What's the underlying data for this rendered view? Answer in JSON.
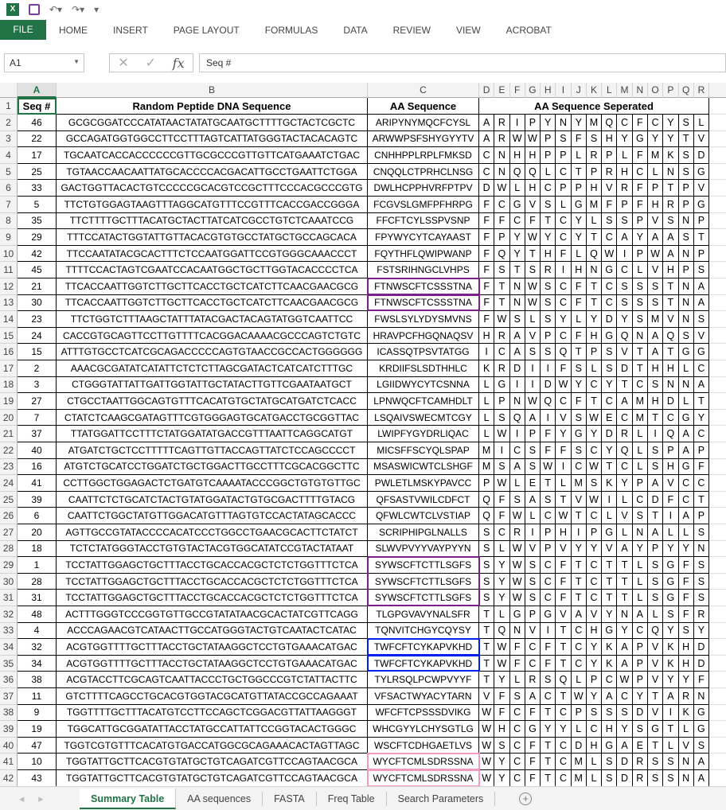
{
  "ribbon": {
    "file": "FILE",
    "tabs": [
      "HOME",
      "INSERT",
      "PAGE LAYOUT",
      "FORMULAS",
      "DATA",
      "REVIEW",
      "VIEW",
      "ACROBAT"
    ]
  },
  "formula_bar": {
    "name_box": "A1",
    "formula": "Seq #",
    "fx": "fx"
  },
  "columns": [
    "A",
    "B",
    "C",
    "D",
    "E",
    "F",
    "G",
    "H",
    "I",
    "J",
    "K",
    "L",
    "M",
    "N",
    "O",
    "P",
    "Q",
    "R"
  ],
  "headers": {
    "seq": "Seq #",
    "dna": "Random Peptide DNA Sequence",
    "aa": "AA Sequence",
    "sep": "AA Sequence Seperated"
  },
  "box_colors": {
    "purple": "#7B1F8A",
    "blue": "#0020F0",
    "pink": "#F49AC1"
  },
  "rows": [
    {
      "seq": "46",
      "dna": "GCGCGGATCCCATATAACTATATGCAATGCTTTTGCTACTCGCTC",
      "aa": "ARIPYNYMQCFCYSL"
    },
    {
      "seq": "22",
      "dna": "GCCAGATGGTGGCCTTCCTTTAGTCATTATGGGTACTACACAGTC",
      "aa": "ARWWPSFSHYGYYTV"
    },
    {
      "seq": "17",
      "dna": "TGCAATCACCACCCCCCGTTGCGCCCGTTGTTCATGAAATCTGAC",
      "aa": "CNHHPPLRPLFMKSD"
    },
    {
      "seq": "25",
      "dna": "TGTAACCAACAATTATGCACCCCACGACATTGCCTGAATTCTGGA",
      "aa": "CNQQLCTPRHCLNSG"
    },
    {
      "seq": "33",
      "dna": "GACTGGTTACACTGTCCCCCGCACGTCCGCTTTCCCACGCCCGTG",
      "aa": "DWLHCPPHVRFPTPV"
    },
    {
      "seq": "5",
      "dna": "TTCTGTGGAGTAAGTTTAGGCATGTTTCCGTTTCACCGACCGGGA",
      "aa": "FCGVSLGMFPFHRPG"
    },
    {
      "seq": "35",
      "dna": "TTCTTTTGCTTTACATGCTACTTATCATCGCCTGTCTCAAATCCG",
      "aa": "FFCFTCYLSSPVSNP"
    },
    {
      "seq": "29",
      "dna": "TTTCCATACTGGTATTGTTACACGTGTGCCTATGCTGCCAGCACA",
      "aa": "FPYWYCYTCAYAAST"
    },
    {
      "seq": "42",
      "dna": "TTCCAATATACGCACTTTCTCCAATGGATTCCGTGGGCAAACCCT",
      "aa": "FQYTHFLQWIPWANP"
    },
    {
      "seq": "45",
      "dna": "TTTTCCACTAGTCGAATCCACAATGGCTGCTTGGTACACCCCTCA",
      "aa": "FSTSRIHNGCLVHPS"
    },
    {
      "seq": "21",
      "dna": "TTCACCAATTGGTCTTGCTTCACCTGCTCATCTTCAACGAACGCG",
      "aa": "FTNWSCFTCSSSTNA",
      "box": "purple"
    },
    {
      "seq": "30",
      "dna": "TTCACCAATTGGTCTTGCTTCACCTGCTCATCTTCAACGAACGCG",
      "aa": "FTNWSCFTCSSSTNA",
      "box": "purple"
    },
    {
      "seq": "23",
      "dna": "TTCTGGTCTTTAAGCTATTTATACGACTACAGTATGGTCAATTCC",
      "aa": "FWSLSYLYDYSMVNS"
    },
    {
      "seq": "24",
      "dna": "CACCGTGCAGTTCCTTGTTTTCACGGACAAAACGCCCAGTCTGTC",
      "aa": "HRAVPCFHGQNAQSV"
    },
    {
      "seq": "15",
      "dna": "ATTTGTGCCTCATCGCAGACCCCCAGTGTAACCGCCACTGGGGGG",
      "aa": "ICASSQTPSVTATGG"
    },
    {
      "seq": "2",
      "dna": "AAACGCGATATCATATTCTCTCTTAGCGATACTCATCATCTTTGC",
      "aa": "KRDIIFSLSDTHHLC"
    },
    {
      "seq": "3",
      "dna": "CTGGGTATTATTGATTGGTATTGCTATACTTGTTCGAATAATGCT",
      "aa": "LGIIDWYCYTCSNNA"
    },
    {
      "seq": "27",
      "dna": "CTGCCTAATTGGCAGTGTTTCACATGTGCTATGCATGATCTCACC",
      "aa": "LPNWQCFTCAMHDLT"
    },
    {
      "seq": "7",
      "dna": "CTATCTCAAGCGATAGTTTCGTGGGAGTGCATGACCTGCGGTTAC",
      "aa": "LSQAIVSWECMTCGY"
    },
    {
      "seq": "37",
      "dna": "TTATGGATTCCTTTCTATGGATATGACCGTTTAATTCAGGCATGT",
      "aa": "LWIPFYGYDRLIQAC"
    },
    {
      "seq": "40",
      "dna": "ATGATCTGCTCCTTTTTCAGTTGTTACCAGTTATCTCCAGCCCCT",
      "aa": "MICSFFSCYQLSPAP"
    },
    {
      "seq": "16",
      "dna": "ATGTCTGCATCCTGGATCTGCTGGACTTGCCTTTCGCACGGCTTC",
      "aa": "MSASWICWTCLSHGF"
    },
    {
      "seq": "41",
      "dna": "CCTTGGCTGGAGACTCTGATGTCAAAATACCCGGCTGTGTGTTGC",
      "aa": "PWLETLMSKYPAVCC"
    },
    {
      "seq": "39",
      "dna": "CAATTCTCTGCATCTACTGTATGGATACTGTGCGACTTTTGTACG",
      "aa": "QFSASTVWILCDFCT"
    },
    {
      "seq": "6",
      "dna": "CAATTCTGGCTATGTTGGACATGTTTAGTGTCCACTATAGCACCC",
      "aa": "QFWLCWTCLVSTIAP"
    },
    {
      "seq": "20",
      "dna": "AGTTGCCGTATACCCCACATCCCTGGCCTGAACGCACTTCTATCT",
      "aa": "SCRIPHIPGLNALLS"
    },
    {
      "seq": "18",
      "dna": "TCTCTATGGGTACCTGTGTACTACGTGGCATATCCGTACTATAAT",
      "aa": "SLWVPVYYVAYPYYN"
    },
    {
      "seq": "1",
      "dna": "TCCTATTGGAGCTGCTTTACCTGCACCACGCTCTCTGGTTTCTCA",
      "aa": "SYWSCFTCTTLSGFS",
      "box": "purple",
      "group": "start"
    },
    {
      "seq": "28",
      "dna": "TCCTATTGGAGCTGCTTTACCTGCACCACGCTCTCTGGTTTCTCA",
      "aa": "SYWSCFTCTTLSGFS",
      "box": "purple"
    },
    {
      "seq": "31",
      "dna": "TCCTATTGGAGCTGCTTTACCTGCACCACGCTCTCTGGTTTCTCA",
      "aa": "SYWSCFTCTTLSGFS",
      "box": "purple"
    },
    {
      "seq": "48",
      "dna": "ACTTTGGGTCCCGGTGTTGCCGTATATAACGCACTATCGTTCAGG",
      "aa": "TLGPGVAVYNALSFR"
    },
    {
      "seq": "4",
      "dna": "ACCCAGAACGTCATAACTTGCCATGGGTACTGTCAATACTCATAC",
      "aa": "TQNVITCHGYCQYSY"
    },
    {
      "seq": "32",
      "dna": "ACGTGGTTTTGCTTTACCTGCTATAAGGCTCCTGTGAAACATGAC",
      "aa": "TWFCFTCYKAPVKHD",
      "box": "blue"
    },
    {
      "seq": "34",
      "dna": "ACGTGGTTTTGCTTTACCTGCTATAAGGCTCCTGTGAAACATGAC",
      "aa": "TWFCFTCYKAPVKHD",
      "box": "blue"
    },
    {
      "seq": "38",
      "dna": "ACGTACCTTCGCAGTCAATTACCCTGCTGGCCCGTCTATTACTTC",
      "aa": "TYLRSQLPCWPVYYF"
    },
    {
      "seq": "11",
      "dna": "GTCTTTTCAGCCTGCACGTGGTACGCATGTTATACCGCCAGAAAT",
      "aa": "VFSACTWYACYTARN"
    },
    {
      "seq": "9",
      "dna": "TGGTTTTGCTTTACATGTCCTTCCAGCTCGGACGTTATTAAGGGT",
      "aa": "WFCFTCPSSSDVIKG"
    },
    {
      "seq": "19",
      "dna": "TGGCATTGCGGATATTACCTATGCCATTATTCCGGTACACTGGGC",
      "aa": "WHCGYYLCHYSGTLG"
    },
    {
      "seq": "47",
      "dna": "TGGTCGTGTTTCACATGTGACCATGGCGCAGAAACACTAGTTAGC",
      "aa": "WSCFTCDHGAETLVS"
    },
    {
      "seq": "10",
      "dna": "TGGTATTGCTTCACGTGTATGCTGTCAGATCGTTCCAGTAACGCA",
      "aa": "WYCFTCMLSDRSSNA",
      "box": "pink"
    },
    {
      "seq": "43",
      "dna": "TGGTATTGCTTCACGTGTATGCTGTCAGATCGTTCCAGTAACGCA",
      "aa": "WYCFTCMLSDRSSNA",
      "box": "pink"
    }
  ],
  "sheet_tabs": [
    "Summary Table",
    "AA sequences",
    "FASTA",
    "Freq Table",
    "Search Parameters"
  ],
  "active_sheet": "Summary Table"
}
